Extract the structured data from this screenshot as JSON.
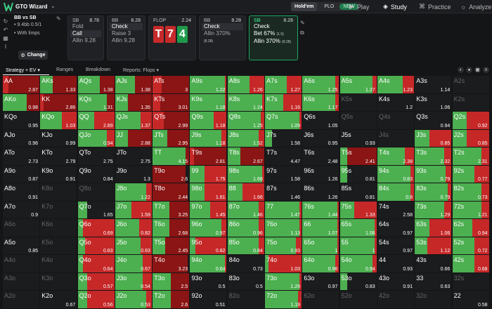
{
  "app": {
    "name": "GTO Wizard",
    "game_tabs": [
      "Hold'em",
      "PLO"
    ],
    "new_badge": "NEW",
    "nav": [
      "Play",
      "Study",
      "Practice",
      "Analyze"
    ]
  },
  "info": {
    "title": "BB vs SB",
    "stack": "9.4bb 0.5/1",
    "limps": "With limps",
    "change": "Change"
  },
  "cards": [
    {
      "pos": "SB",
      "val": "8.78",
      "actions": [
        "Fold",
        "Call",
        "Allin 9.28"
      ],
      "sel": 1
    },
    {
      "pos": "BB",
      "val": "8.28",
      "actions": [
        "Check",
        "Raise 3",
        "Allin 9.28"
      ],
      "sel": 0
    },
    {
      "pos": "FLOP",
      "val": "2.24"
    },
    {
      "pos": "BB",
      "val": "8.28",
      "actions": [
        "Check",
        "Allin 370%"
      ],
      "sub": "(8.28)",
      "sel": 0
    },
    {
      "pos": "SB",
      "val": "8.28",
      "actions": [
        "Check",
        "Bet 67%",
        "Allin 370%"
      ],
      "subs": [
        "",
        "(1.5)",
        "(8.28)"
      ]
    }
  ],
  "flop": [
    "T",
    "7",
    "4"
  ],
  "tabs": [
    "Strategy + EV",
    "Ranges",
    "Breakdown",
    "Reports: Flops"
  ],
  "colors": {
    "check": "#4caf50",
    "bet": "#c62828",
    "allin": "#8b1414",
    "empty": "#1b1c1e"
  },
  "grid": [
    [
      [
        "AA",
        0,
        0.15,
        0.85,
        "2.87"
      ],
      [
        "AKs",
        0.35,
        0,
        0.65,
        "1.33"
      ],
      [
        "AQs",
        0.6,
        0,
        0.4,
        "1.38"
      ],
      [
        "AJs",
        0.55,
        0,
        0.45,
        "1.38"
      ],
      [
        "ATs",
        0,
        0.25,
        0.75,
        "3"
      ],
      [
        "A9s",
        0.95,
        0.05,
        0,
        "1.22"
      ],
      [
        "A8s",
        0.6,
        0.4,
        0,
        "1.26"
      ],
      [
        "A7s",
        0.6,
        0.4,
        0,
        "1.27"
      ],
      [
        "A6s",
        0.9,
        0.1,
        0,
        "1.25"
      ],
      [
        "A5s",
        0.9,
        0.1,
        0,
        "1.27"
      ],
      [
        "A4s",
        0.7,
        0.3,
        0,
        "1.23"
      ],
      [
        "A3s",
        0,
        0,
        0,
        "1.14"
      ],
      [
        "A2s",
        -1,
        0,
        0,
        ""
      ]
    ],
    [
      [
        "AKo",
        0.65,
        0,
        0.35,
        "0.98"
      ],
      [
        "KK",
        0,
        0.1,
        0.9,
        "2.86"
      ],
      [
        "KQs",
        0.8,
        0,
        0.2,
        "1.31"
      ],
      [
        "KJs",
        0.35,
        0,
        0.65,
        "1.35"
      ],
      [
        "KTs",
        0,
        0.2,
        0.8,
        "3.01"
      ],
      [
        "K9s",
        0.95,
        0.05,
        0,
        "1.18"
      ],
      [
        "K8s",
        0.95,
        0.05,
        0,
        "1.24"
      ],
      [
        "K7s",
        0.5,
        0.5,
        0,
        "1.16"
      ],
      [
        "K6s",
        0.9,
        0.1,
        0,
        "1.17"
      ],
      [
        "K5s",
        -1,
        0,
        0,
        ""
      ],
      [
        "K4s",
        0,
        0,
        0,
        "1.2"
      ],
      [
        "K3s",
        0,
        0,
        0,
        "1.06"
      ],
      [
        "K2s",
        -1,
        0,
        0,
        ""
      ]
    ],
    [
      [
        "KQo",
        0,
        0,
        0,
        "0.95"
      ],
      [
        "KQo",
        0.6,
        0.4,
        0,
        "1.03"
      ],
      [
        "QQ",
        0.45,
        0.55,
        0,
        "2.89"
      ],
      [
        "QJs",
        0.7,
        0.3,
        0,
        "1.37"
      ],
      [
        "QTs",
        0,
        0.3,
        0.7,
        "2.99"
      ],
      [
        "Q9s",
        0.65,
        0.35,
        0,
        "1.18"
      ],
      [
        "Q8s",
        0.9,
        0.1,
        0,
        "1.25"
      ],
      [
        "Q7s",
        0.95,
        0.05,
        0,
        "1.09"
      ],
      [
        "Q6s",
        0,
        0,
        0,
        "1.05"
      ],
      [
        "Q5s",
        -1,
        0,
        0,
        ""
      ],
      [
        "Q4s",
        -1,
        0,
        0,
        ""
      ],
      [
        "Q3s",
        0,
        0,
        0,
        "0.94"
      ],
      [
        "Q2s",
        0.4,
        0.6,
        0,
        "0.92"
      ]
    ],
    [
      [
        "AJo",
        0,
        0,
        0,
        "0.96"
      ],
      [
        "KJo",
        0,
        0,
        0,
        "0.99"
      ],
      [
        "QJo",
        0.8,
        0.2,
        0,
        "0.94"
      ],
      [
        "JJ",
        0.35,
        0,
        0.65,
        "2.88"
      ],
      [
        "JTs",
        0.4,
        0,
        0.6,
        "2.95"
      ],
      [
        "J9s",
        0.85,
        0.15,
        0,
        "1.18"
      ],
      [
        "J8s",
        0.85,
        0.15,
        0,
        "1.52"
      ],
      [
        "J7s",
        0.2,
        0,
        0,
        "1.58"
      ],
      [
        "J6s",
        0,
        0,
        0,
        "0.95"
      ],
      [
        "J5s",
        0,
        0,
        0,
        "0.93"
      ],
      [
        "J4s",
        -1,
        0,
        0,
        ""
      ],
      [
        "J3s",
        0.4,
        0.6,
        0,
        "0.85"
      ],
      [
        "J2s",
        0.4,
        0.6,
        0,
        "0.85"
      ]
    ],
    [
      [
        "ATo",
        0,
        0,
        0,
        "2.73"
      ],
      [
        "KTo",
        0,
        0,
        0,
        "2.79"
      ],
      [
        "QTo",
        0,
        0,
        0,
        "2.75"
      ],
      [
        "JTo",
        0,
        0,
        0,
        "2.75"
      ],
      [
        "TT",
        0.9,
        0,
        0.1,
        "4.15"
      ],
      [
        "T9s",
        0,
        0.1,
        0.9,
        "2.81"
      ],
      [
        "T8s",
        0.35,
        0,
        0.65,
        "2.67"
      ],
      [
        "T7s",
        0,
        0,
        0,
        "4.47"
      ],
      [
        "T6s",
        0,
        0,
        0,
        "2.48"
      ],
      [
        "T5s",
        0.2,
        0,
        0.8,
        "2.41"
      ],
      [
        "T4s",
        0.75,
        0.25,
        0,
        "2.38"
      ],
      [
        "T3s",
        0.8,
        0.2,
        0,
        "2.32"
      ],
      [
        "T2s",
        0.8,
        0.2,
        0,
        "2.31"
      ]
    ],
    [
      [
        "A9o",
        0,
        0,
        0,
        "0.87"
      ],
      [
        "K9o",
        0,
        0,
        0,
        "0.91"
      ],
      [
        "Q9o",
        0,
        0,
        0,
        "0.84"
      ],
      [
        "J9o",
        0,
        0,
        0,
        "1.3"
      ],
      [
        "T9o",
        0,
        0,
        0.9,
        "2.6"
      ],
      [
        "99",
        0.4,
        0.6,
        0,
        "1.75"
      ],
      [
        "98s",
        0.95,
        0.05,
        0,
        "1.68"
      ],
      [
        "97s",
        0,
        0,
        0,
        "1.58"
      ],
      [
        "96s",
        0,
        0,
        0,
        "1.26"
      ],
      [
        "95s",
        0.2,
        0,
        0,
        "0.81"
      ],
      [
        "94s",
        0.9,
        0.1,
        0,
        "0.83"
      ],
      [
        "93s",
        0.85,
        0.15,
        0,
        "0.79"
      ],
      [
        "92s",
        0.6,
        0.4,
        0,
        "0.77"
      ]
    ],
    [
      [
        "A8o",
        0,
        0,
        0,
        "0.91"
      ],
      [
        "K8o",
        -1,
        0,
        0,
        ""
      ],
      [
        "Q8o",
        -1,
        0,
        0,
        ""
      ],
      [
        "J8o",
        0.85,
        0.15,
        0,
        "1.22"
      ],
      [
        "T8o",
        0,
        0,
        0.95,
        "2.44"
      ],
      [
        "98o",
        0.4,
        0.6,
        0,
        "1.61"
      ],
      [
        "88",
        0.4,
        0.6,
        0,
        "1.66"
      ],
      [
        "87s",
        0,
        0,
        0,
        "1.46"
      ],
      [
        "86s",
        0,
        0,
        0,
        "1.26"
      ],
      [
        "85s",
        0,
        0,
        0,
        "0.81"
      ],
      [
        "84s",
        0.9,
        0.1,
        0,
        "0.8"
      ],
      [
        "83s",
        0.9,
        0.1,
        0,
        "0.79"
      ],
      [
        "82s",
        0.8,
        0.2,
        0,
        "0.73"
      ]
    ],
    [
      [
        "A7o",
        0,
        0,
        0,
        "0.9"
      ],
      [
        "K7o",
        -1,
        0,
        0,
        ""
      ],
      [
        "Q7o",
        0.25,
        0,
        0,
        "1.65"
      ],
      [
        "J7o",
        0.45,
        0.55,
        0,
        "1.59"
      ],
      [
        "T7o",
        0.45,
        0,
        0.55,
        "3.25"
      ],
      [
        "97o",
        0.55,
        0.45,
        0,
        "1.45"
      ],
      [
        "87o",
        0.85,
        0.15,
        0,
        "1.46"
      ],
      [
        "77",
        0.95,
        0.05,
        0,
        "1.47"
      ],
      [
        "76s",
        0.95,
        0.05,
        0,
        "1.44"
      ],
      [
        "75s",
        0.4,
        0.6,
        0,
        "1.33"
      ],
      [
        "74s",
        0,
        0,
        0,
        "2.58"
      ],
      [
        "73s",
        0.8,
        0.2,
        0,
        "1.29"
      ],
      [
        "72s",
        0.8,
        0.2,
        0,
        "1.21"
      ]
    ],
    [
      [
        "A6o",
        -1,
        0,
        0,
        ""
      ],
      [
        "K6o",
        -1,
        0,
        0,
        ""
      ],
      [
        "Q6o",
        0.15,
        0.85,
        0,
        "0.69"
      ],
      [
        "J6o",
        0.65,
        0.35,
        0,
        "0.82"
      ],
      [
        "T6o",
        0.45,
        0,
        0.55,
        "2.68"
      ],
      [
        "96o",
        0.85,
        0.15,
        0,
        "0.97"
      ],
      [
        "86o",
        0.85,
        0.15,
        0,
        "0.96"
      ],
      [
        "76o",
        0.95,
        0.05,
        0,
        "1.13"
      ],
      [
        "66",
        0.95,
        0.05,
        0,
        "1.07"
      ],
      [
        "65s",
        0.95,
        0.05,
        0,
        "1.06"
      ],
      [
        "64s",
        0,
        0,
        0,
        "0.97"
      ],
      [
        "63s",
        0.4,
        0.6,
        0,
        "1.06"
      ],
      [
        "62s",
        0.55,
        0.45,
        0,
        "0.94"
      ]
    ],
    [
      [
        "A5o",
        0,
        0,
        0,
        "0.85"
      ],
      [
        "K5o",
        -1,
        0,
        0,
        ""
      ],
      [
        "Q5o",
        0.2,
        0.8,
        0,
        "0.63"
      ],
      [
        "J5o",
        0.7,
        0.3,
        0,
        "0.63"
      ],
      [
        "T5o",
        0.35,
        0,
        0.65,
        "2.45"
      ],
      [
        "95o",
        0.15,
        0.85,
        0,
        "0.82"
      ],
      [
        "85o",
        0.85,
        0.15,
        0,
        "0.84"
      ],
      [
        "75o",
        0.85,
        0.15,
        0,
        "0.93"
      ],
      [
        "65o",
        0.95,
        0.05,
        0,
        "1"
      ],
      [
        "55",
        0.95,
        0.05,
        0,
        "1"
      ],
      [
        "54s",
        0,
        0,
        0,
        "0.97"
      ],
      [
        "53s",
        0.35,
        0.65,
        0,
        "1.12"
      ],
      [
        "52s",
        0.6,
        0.4,
        0,
        "0.72"
      ]
    ],
    [
      [
        "A4o",
        -1,
        0,
        0,
        ""
      ],
      [
        "K4o",
        -1,
        0,
        0,
        ""
      ],
      [
        "Q4o",
        0.15,
        0.85,
        0,
        "0.64"
      ],
      [
        "J4o",
        0.75,
        0.25,
        0,
        "0.67"
      ],
      [
        "T4o",
        0,
        0,
        0.95,
        "3.23"
      ],
      [
        "94o",
        0.95,
        0.05,
        0,
        "0.64"
      ],
      [
        "84o",
        0,
        0,
        0,
        "0.73"
      ],
      [
        "74o",
        0.1,
        0.9,
        0,
        "1.03"
      ],
      [
        "64o",
        0.9,
        0.1,
        0,
        "0.96"
      ],
      [
        "54o",
        0.9,
        0.1,
        0,
        "0.94"
      ],
      [
        "44",
        0,
        0,
        0,
        "0.93"
      ],
      [
        "43s",
        0,
        0,
        0,
        "0.66"
      ],
      [
        "42s",
        0.6,
        0.4,
        0,
        "0.68"
      ]
    ],
    [
      [
        "A3o",
        -1,
        0,
        0,
        ""
      ],
      [
        "K3o",
        -1,
        0,
        0,
        ""
      ],
      [
        "Q3o",
        0.25,
        0.75,
        0,
        "0.57"
      ],
      [
        "J3o",
        0.75,
        0.25,
        0,
        "0.54"
      ],
      [
        "T3o",
        0.5,
        0,
        0.5,
        "2.5"
      ],
      [
        "93o",
        0,
        0,
        0,
        "0.5"
      ],
      [
        "83o",
        0,
        0,
        0,
        "0.5"
      ],
      [
        "73o",
        0.95,
        0.05,
        0,
        "1.29"
      ],
      [
        "63o",
        0,
        0,
        0,
        "0.97"
      ],
      [
        "53o",
        0.2,
        0,
        0,
        "0.83"
      ],
      [
        "43o",
        0,
        0,
        0,
        "0.91"
      ],
      [
        "33",
        0,
        0,
        0,
        "0.63"
      ],
      [
        "32s",
        -1,
        0,
        0,
        ""
      ]
    ],
    [
      [
        "A2o",
        -1,
        0,
        0,
        ""
      ],
      [
        "K2o",
        0,
        0,
        0,
        "0.67"
      ],
      [
        "Q2o",
        0.25,
        0.75,
        0,
        "0.56"
      ],
      [
        "J2o",
        0.85,
        0.15,
        0,
        "0.53"
      ],
      [
        "T2o",
        0.5,
        0,
        0.5,
        "2.6"
      ],
      [
        "92o",
        0,
        0,
        0,
        "0.51"
      ],
      [
        "82o",
        -1,
        0,
        0,
        ""
      ],
      [
        "72o",
        0.9,
        0.1,
        0,
        "1.19"
      ],
      [
        "62o",
        -1,
        0,
        0,
        ""
      ],
      [
        "52o",
        -1,
        0,
        0,
        ""
      ],
      [
        "42o",
        -1,
        0,
        0,
        ""
      ],
      [
        "32o",
        -1,
        0,
        0,
        ""
      ],
      [
        "22",
        0,
        0,
        0,
        "0.58"
      ]
    ]
  ]
}
